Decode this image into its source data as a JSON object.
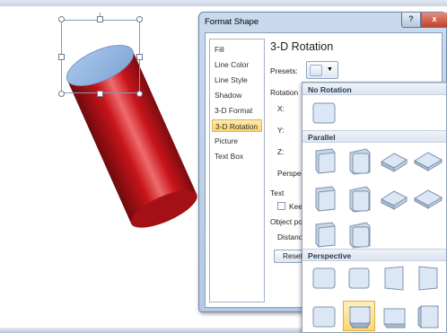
{
  "dialog": {
    "title": "Format Shape",
    "help_label": "?",
    "close_label": "x"
  },
  "categories": [
    "Fill",
    "Line Color",
    "Line Style",
    "Shadow",
    "3-D Format",
    "3-D Rotation",
    "Picture",
    "Text Box"
  ],
  "active_category": "3-D Rotation",
  "pane": {
    "title": "3-D Rotation",
    "presets_label": "Presets:",
    "rotation_label": "Rotation",
    "x_label": "X:",
    "y_label": "Y:",
    "z_label": "Z:",
    "perspective_label": "Perspect",
    "text_label": "Text",
    "keep_label": "Keep",
    "object_position_label": "Object pos",
    "distance_label": "Distance",
    "reset_label": "Reset"
  },
  "gallery": {
    "sections": [
      {
        "title": "No Rotation",
        "count": 1
      },
      {
        "title": "Parallel",
        "count": 10
      },
      {
        "title": "Perspective",
        "count": 8
      }
    ],
    "selected_section": "Perspective",
    "selected_index": 5
  },
  "colors": {
    "cylinder_red": "#c8141b",
    "cylinder_top": "#8fb4e1",
    "selected_highlight": "#fbd774",
    "tile_face": "#dbe7f5"
  },
  "icons": [
    "help-icon",
    "close-icon",
    "dropdown-arrow-icon",
    "checkbox-icon"
  ]
}
